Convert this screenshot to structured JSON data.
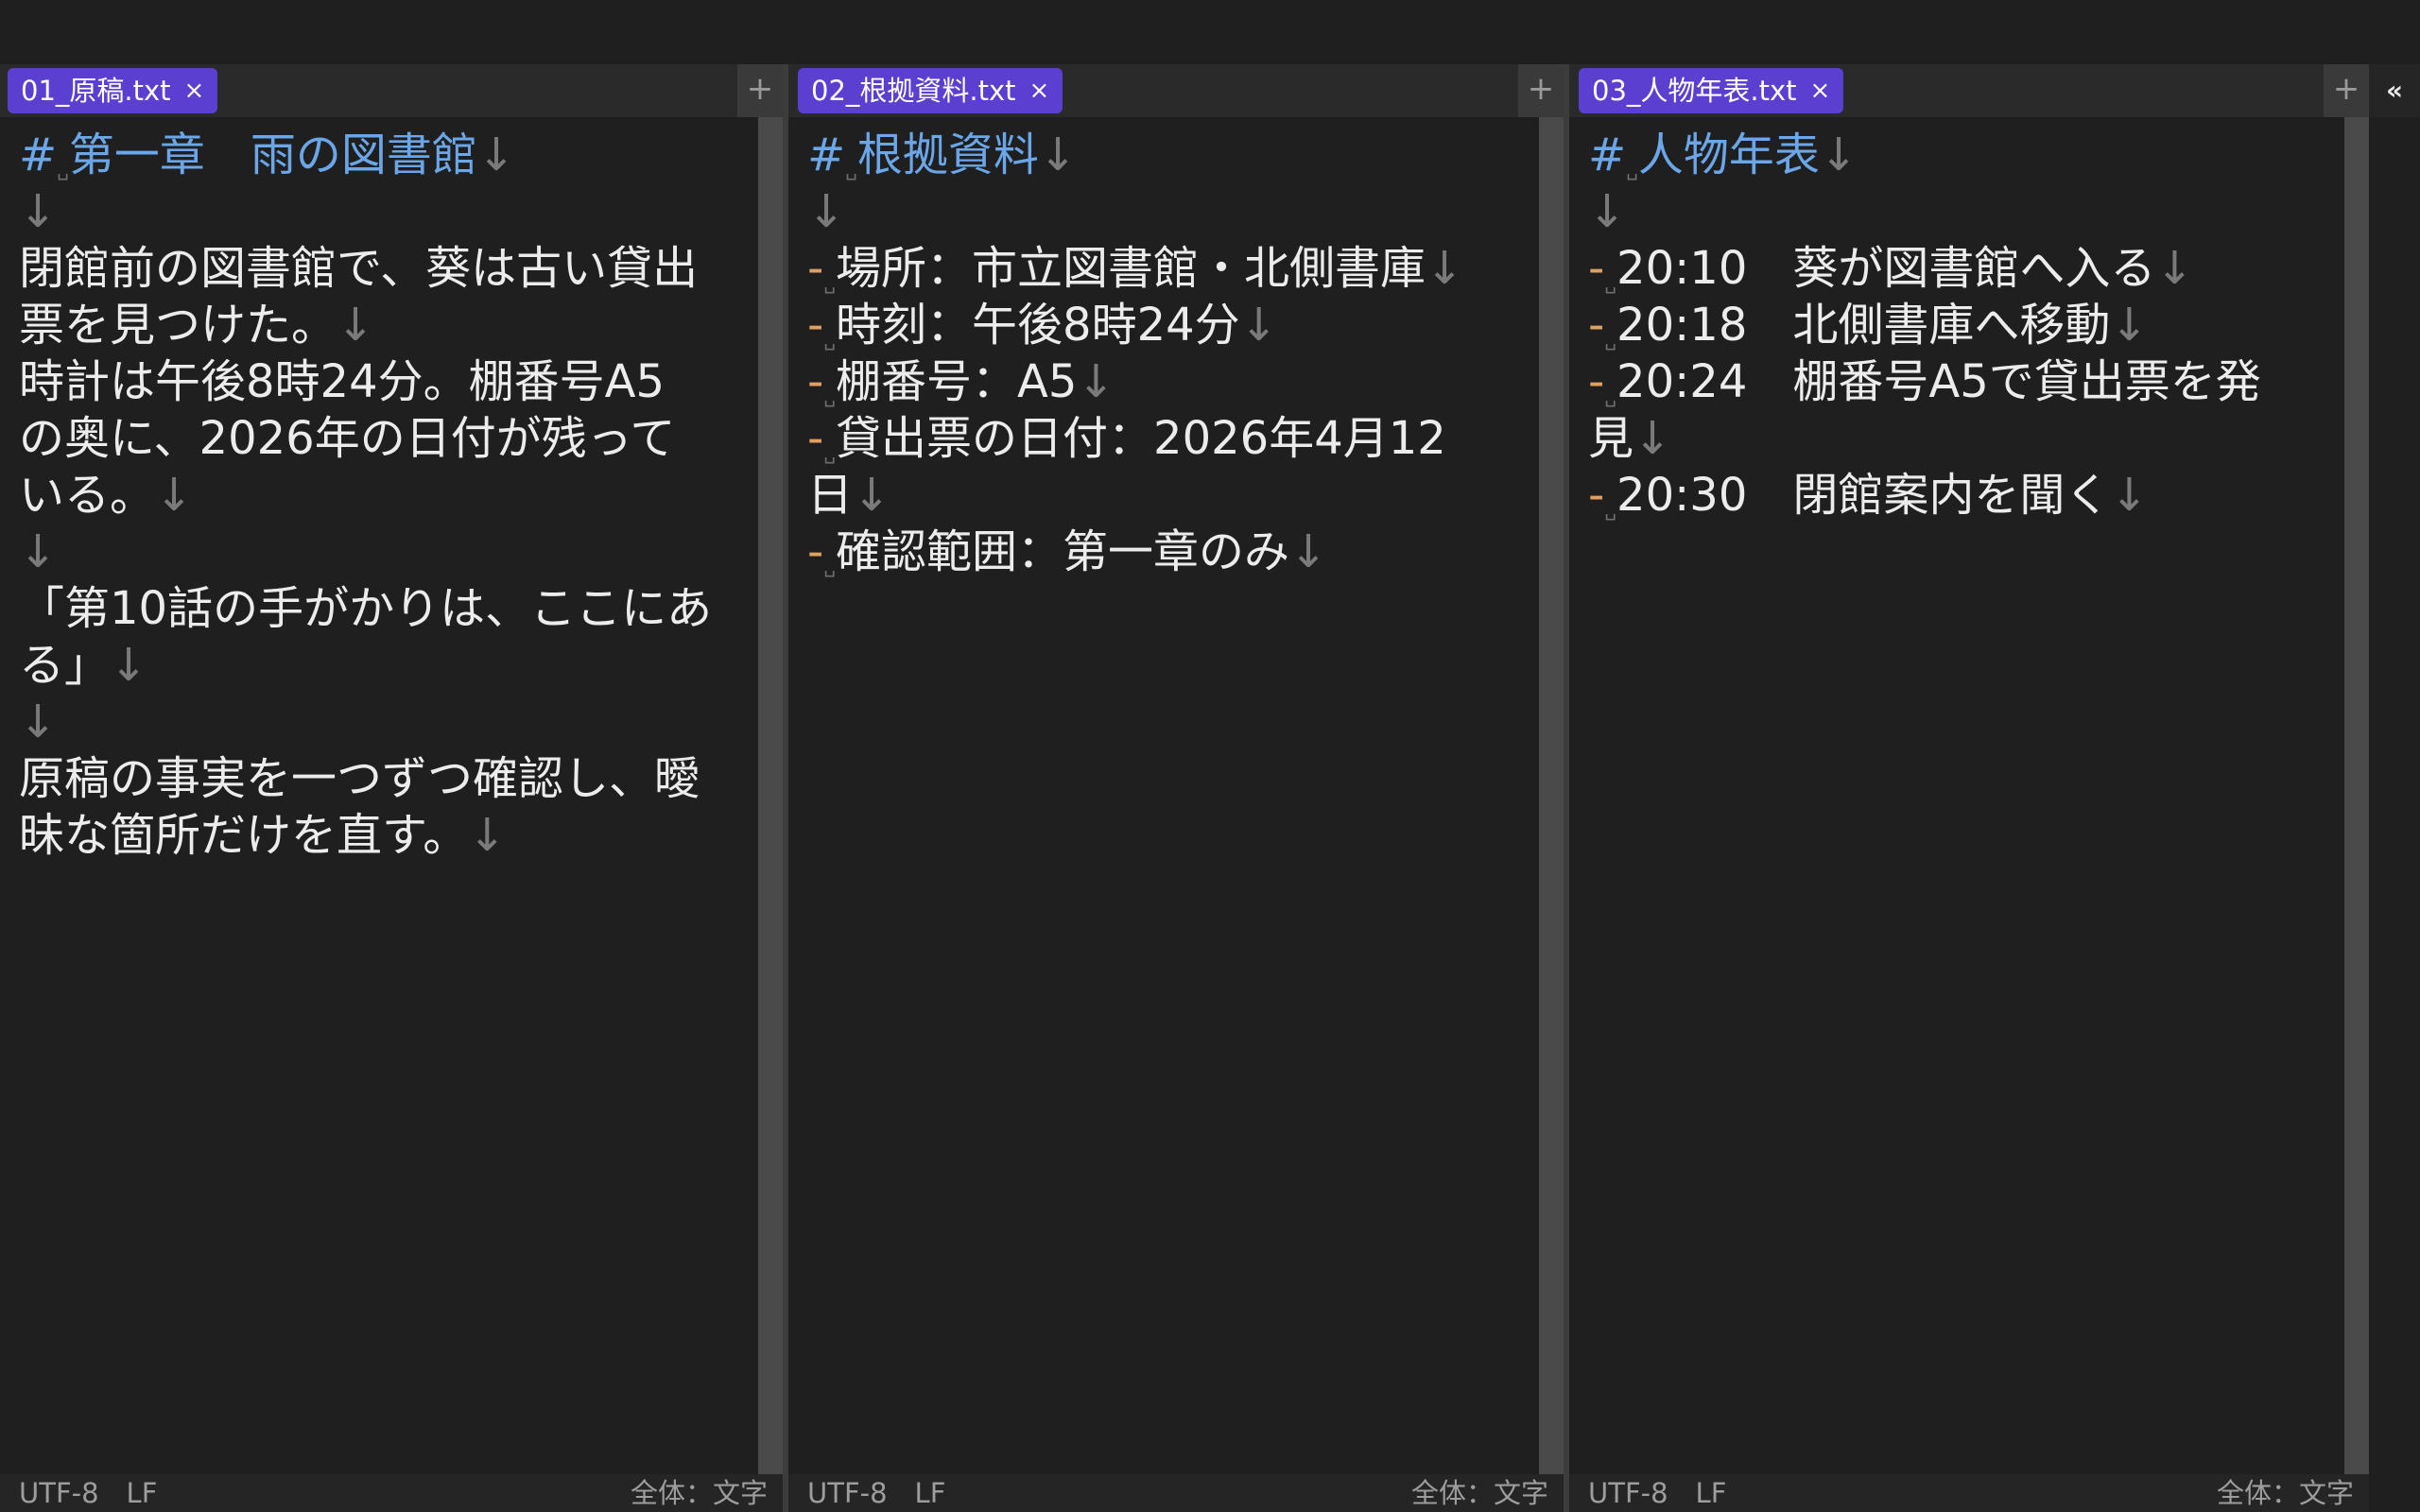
{
  "panes": [
    {
      "tab": {
        "label": "01_原稿.txt",
        "close": "×"
      },
      "plus": "+",
      "lines": [
        [
          {
            "t": "#",
            "c": "h"
          },
          {
            "t": "␣",
            "c": "sp"
          },
          {
            "t": "第一章　雨の図書館",
            "c": "h"
          },
          {
            "t": "↓",
            "c": "nl"
          }
        ],
        [
          {
            "t": "↓",
            "c": "nl"
          }
        ],
        [
          {
            "t": "閉館前の図書館で、葵は古い貸出",
            "c": ""
          }
        ],
        [
          {
            "t": "票を見つけた。",
            "c": ""
          },
          {
            "t": "↓",
            "c": "nl"
          }
        ],
        [
          {
            "t": "時計は午後8時24分。棚番号A5",
            "c": ""
          }
        ],
        [
          {
            "t": "の奥に、2026年の日付が残って",
            "c": ""
          }
        ],
        [
          {
            "t": "いる。",
            "c": ""
          },
          {
            "t": "↓",
            "c": "nl"
          }
        ],
        [
          {
            "t": "↓",
            "c": "nl"
          }
        ],
        [
          {
            "t": "「第10話の手がかりは、ここにあ",
            "c": ""
          }
        ],
        [
          {
            "t": "る」",
            "c": ""
          },
          {
            "t": "↓",
            "c": "nl"
          }
        ],
        [
          {
            "t": "↓",
            "c": "nl"
          }
        ],
        [
          {
            "t": "原稿の事実を一つずつ確認し、曖",
            "c": ""
          }
        ],
        [
          {
            "t": "昧な箇所だけを直す。",
            "c": ""
          },
          {
            "t": "↓",
            "c": "nl"
          }
        ]
      ],
      "status": {
        "left": "UTF-8　LF",
        "right": "全体：文字"
      }
    },
    {
      "tab": {
        "label": "02_根拠資料.txt",
        "close": "×"
      },
      "plus": "+",
      "lines": [
        [
          {
            "t": "#",
            "c": "h"
          },
          {
            "t": "␣",
            "c": "sp"
          },
          {
            "t": "根拠資料",
            "c": "h"
          },
          {
            "t": "↓",
            "c": "nl"
          }
        ],
        [
          {
            "t": "↓",
            "c": "nl"
          }
        ],
        [
          {
            "t": "-",
            "c": "bullet"
          },
          {
            "t": "␣",
            "c": "sp"
          },
          {
            "t": "場所：市立図書館・北側書庫",
            "c": ""
          },
          {
            "t": "↓",
            "c": "nl"
          }
        ],
        [
          {
            "t": "-",
            "c": "bullet"
          },
          {
            "t": "␣",
            "c": "sp"
          },
          {
            "t": "時刻：午後8時24分",
            "c": ""
          },
          {
            "t": "↓",
            "c": "nl"
          }
        ],
        [
          {
            "t": "-",
            "c": "bullet"
          },
          {
            "t": "␣",
            "c": "sp"
          },
          {
            "t": "棚番号：A5",
            "c": ""
          },
          {
            "t": "↓",
            "c": "nl"
          }
        ],
        [
          {
            "t": "-",
            "c": "bullet"
          },
          {
            "t": "␣",
            "c": "sp"
          },
          {
            "t": "貸出票の日付：2026年4月12",
            "c": ""
          }
        ],
        [
          {
            "t": "日",
            "c": ""
          },
          {
            "t": "↓",
            "c": "nl"
          }
        ],
        [
          {
            "t": "-",
            "c": "bullet"
          },
          {
            "t": "␣",
            "c": "sp"
          },
          {
            "t": "確認範囲：第一章のみ",
            "c": ""
          },
          {
            "t": "↓",
            "c": "nl"
          }
        ]
      ],
      "status": {
        "left": "UTF-8　LF",
        "right": "全体：文字"
      }
    },
    {
      "tab": {
        "label": "03_人物年表.txt",
        "close": "×"
      },
      "plus": "+",
      "lines": [
        [
          {
            "t": "#",
            "c": "h"
          },
          {
            "t": "␣",
            "c": "sp"
          },
          {
            "t": "人物年表",
            "c": "h"
          },
          {
            "t": "↓",
            "c": "nl"
          }
        ],
        [
          {
            "t": "↓",
            "c": "nl"
          }
        ],
        [
          {
            "t": "-",
            "c": "bullet"
          },
          {
            "t": "␣",
            "c": "sp"
          },
          {
            "t": "20:10　葵が図書館へ入る",
            "c": ""
          },
          {
            "t": "↓",
            "c": "nl"
          }
        ],
        [
          {
            "t": "-",
            "c": "bullet"
          },
          {
            "t": "␣",
            "c": "sp"
          },
          {
            "t": "20:18　北側書庫へ移動",
            "c": ""
          },
          {
            "t": "↓",
            "c": "nl"
          }
        ],
        [
          {
            "t": "-",
            "c": "bullet"
          },
          {
            "t": "␣",
            "c": "sp"
          },
          {
            "t": "20:24　棚番号A5で貸出票を発",
            "c": ""
          }
        ],
        [
          {
            "t": "見",
            "c": ""
          },
          {
            "t": "↓",
            "c": "nl"
          }
        ],
        [
          {
            "t": "-",
            "c": "bullet"
          },
          {
            "t": "␣",
            "c": "sp"
          },
          {
            "t": "20:30　閉館案内を聞く",
            "c": ""
          },
          {
            "t": "↓",
            "c": "nl"
          }
        ]
      ],
      "status": {
        "left": "UTF-8　LF",
        "right": "全体：文字"
      }
    }
  ],
  "collapse_button": "«"
}
